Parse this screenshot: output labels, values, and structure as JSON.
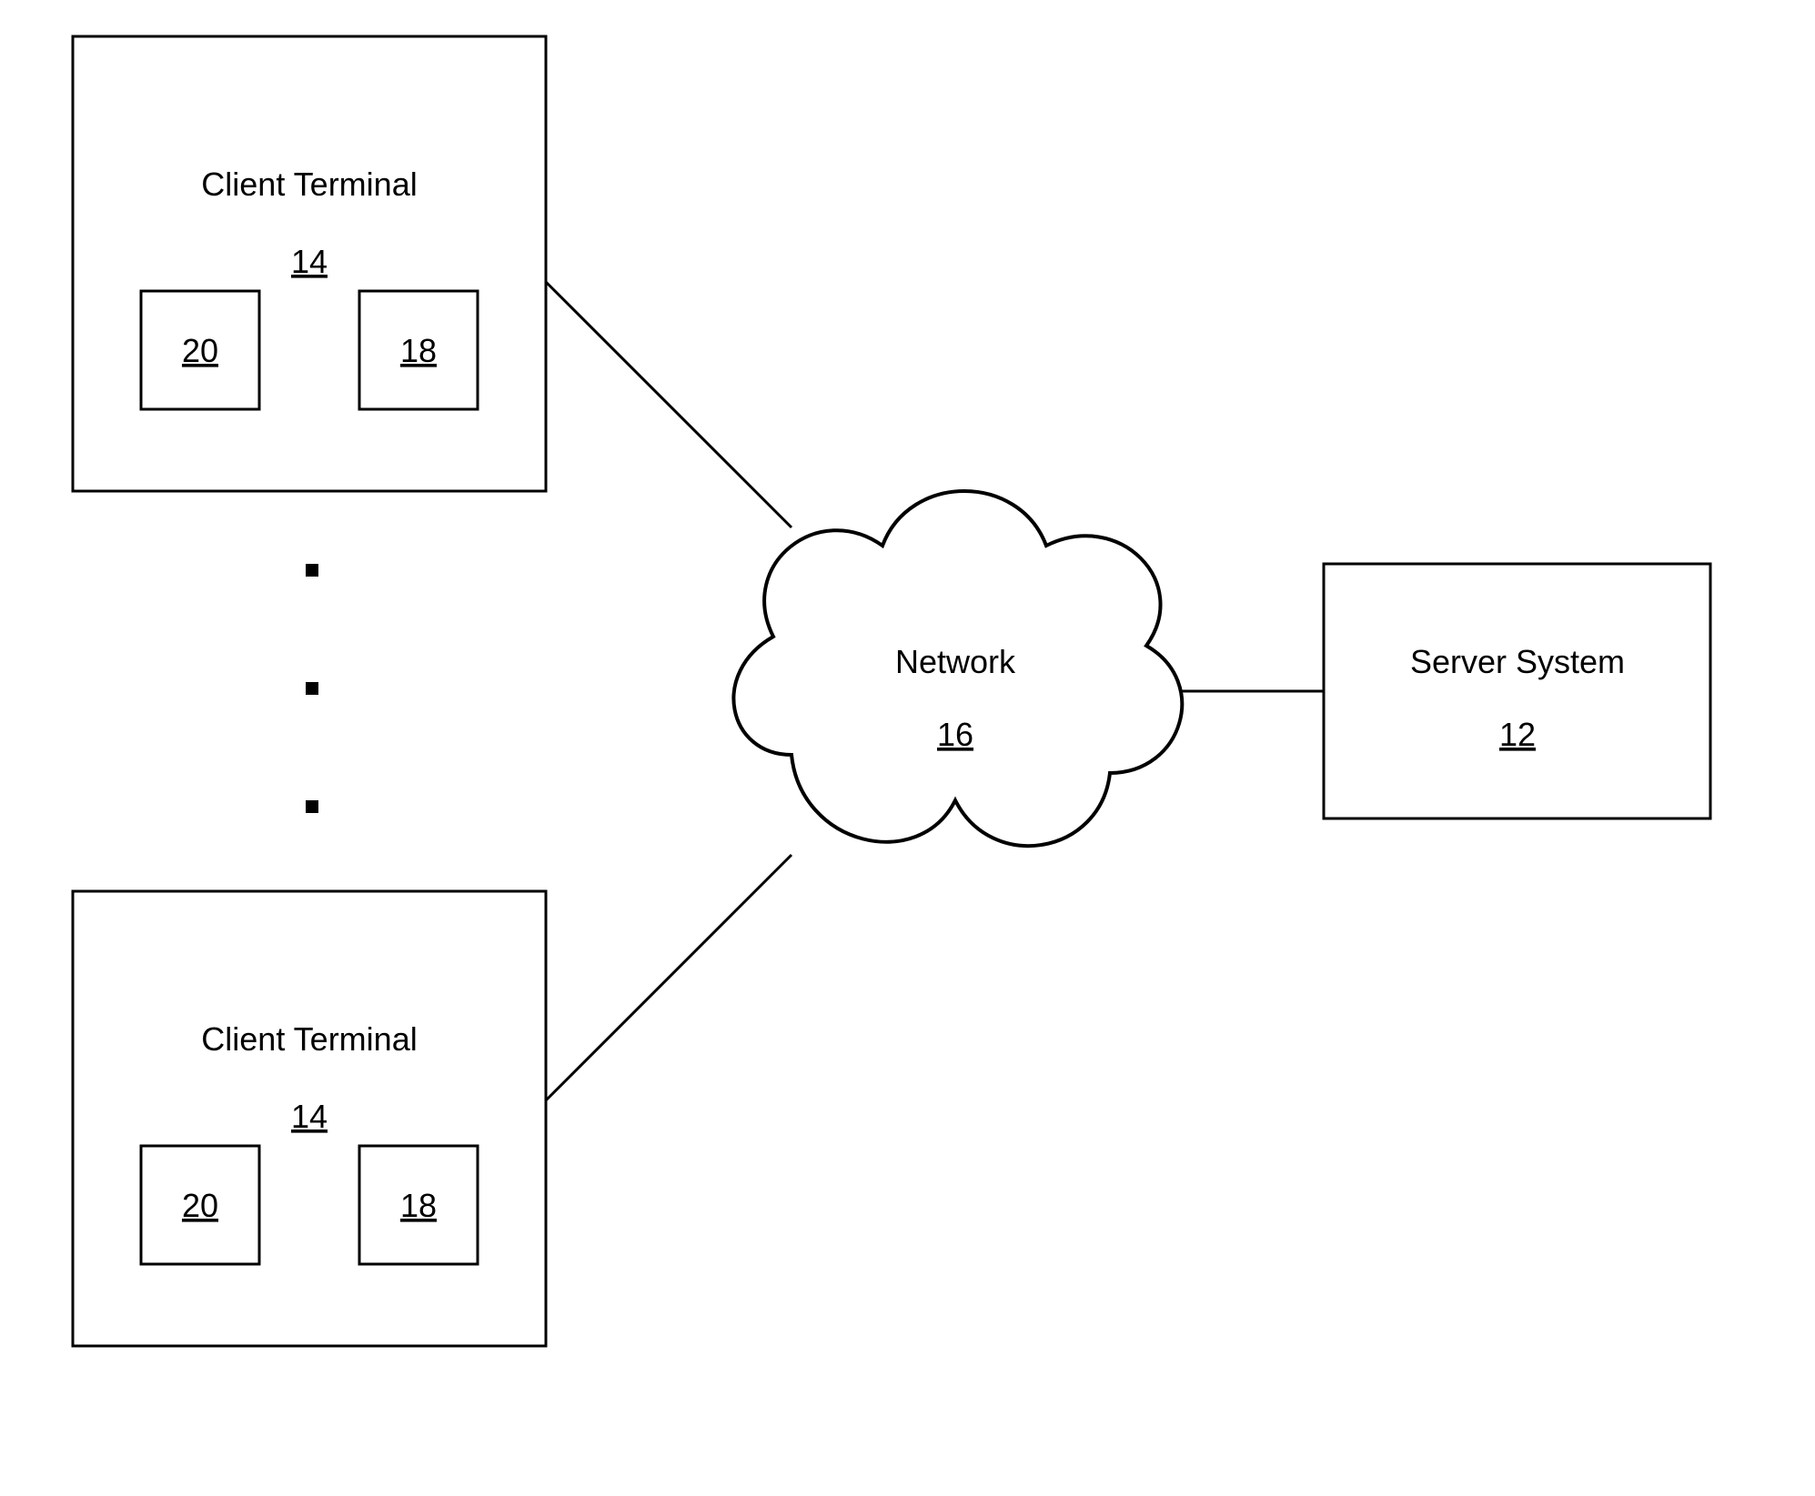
{
  "diagram": {
    "clientTerminal1": {
      "title": "Client Terminal",
      "ref": "14",
      "sub1": "20",
      "sub2": "18"
    },
    "clientTerminal2": {
      "title": "Client Terminal",
      "ref": "14",
      "sub1": "20",
      "sub2": "18"
    },
    "network": {
      "title": "Network",
      "ref": "16"
    },
    "server": {
      "title": "Server System",
      "ref": "12"
    }
  }
}
